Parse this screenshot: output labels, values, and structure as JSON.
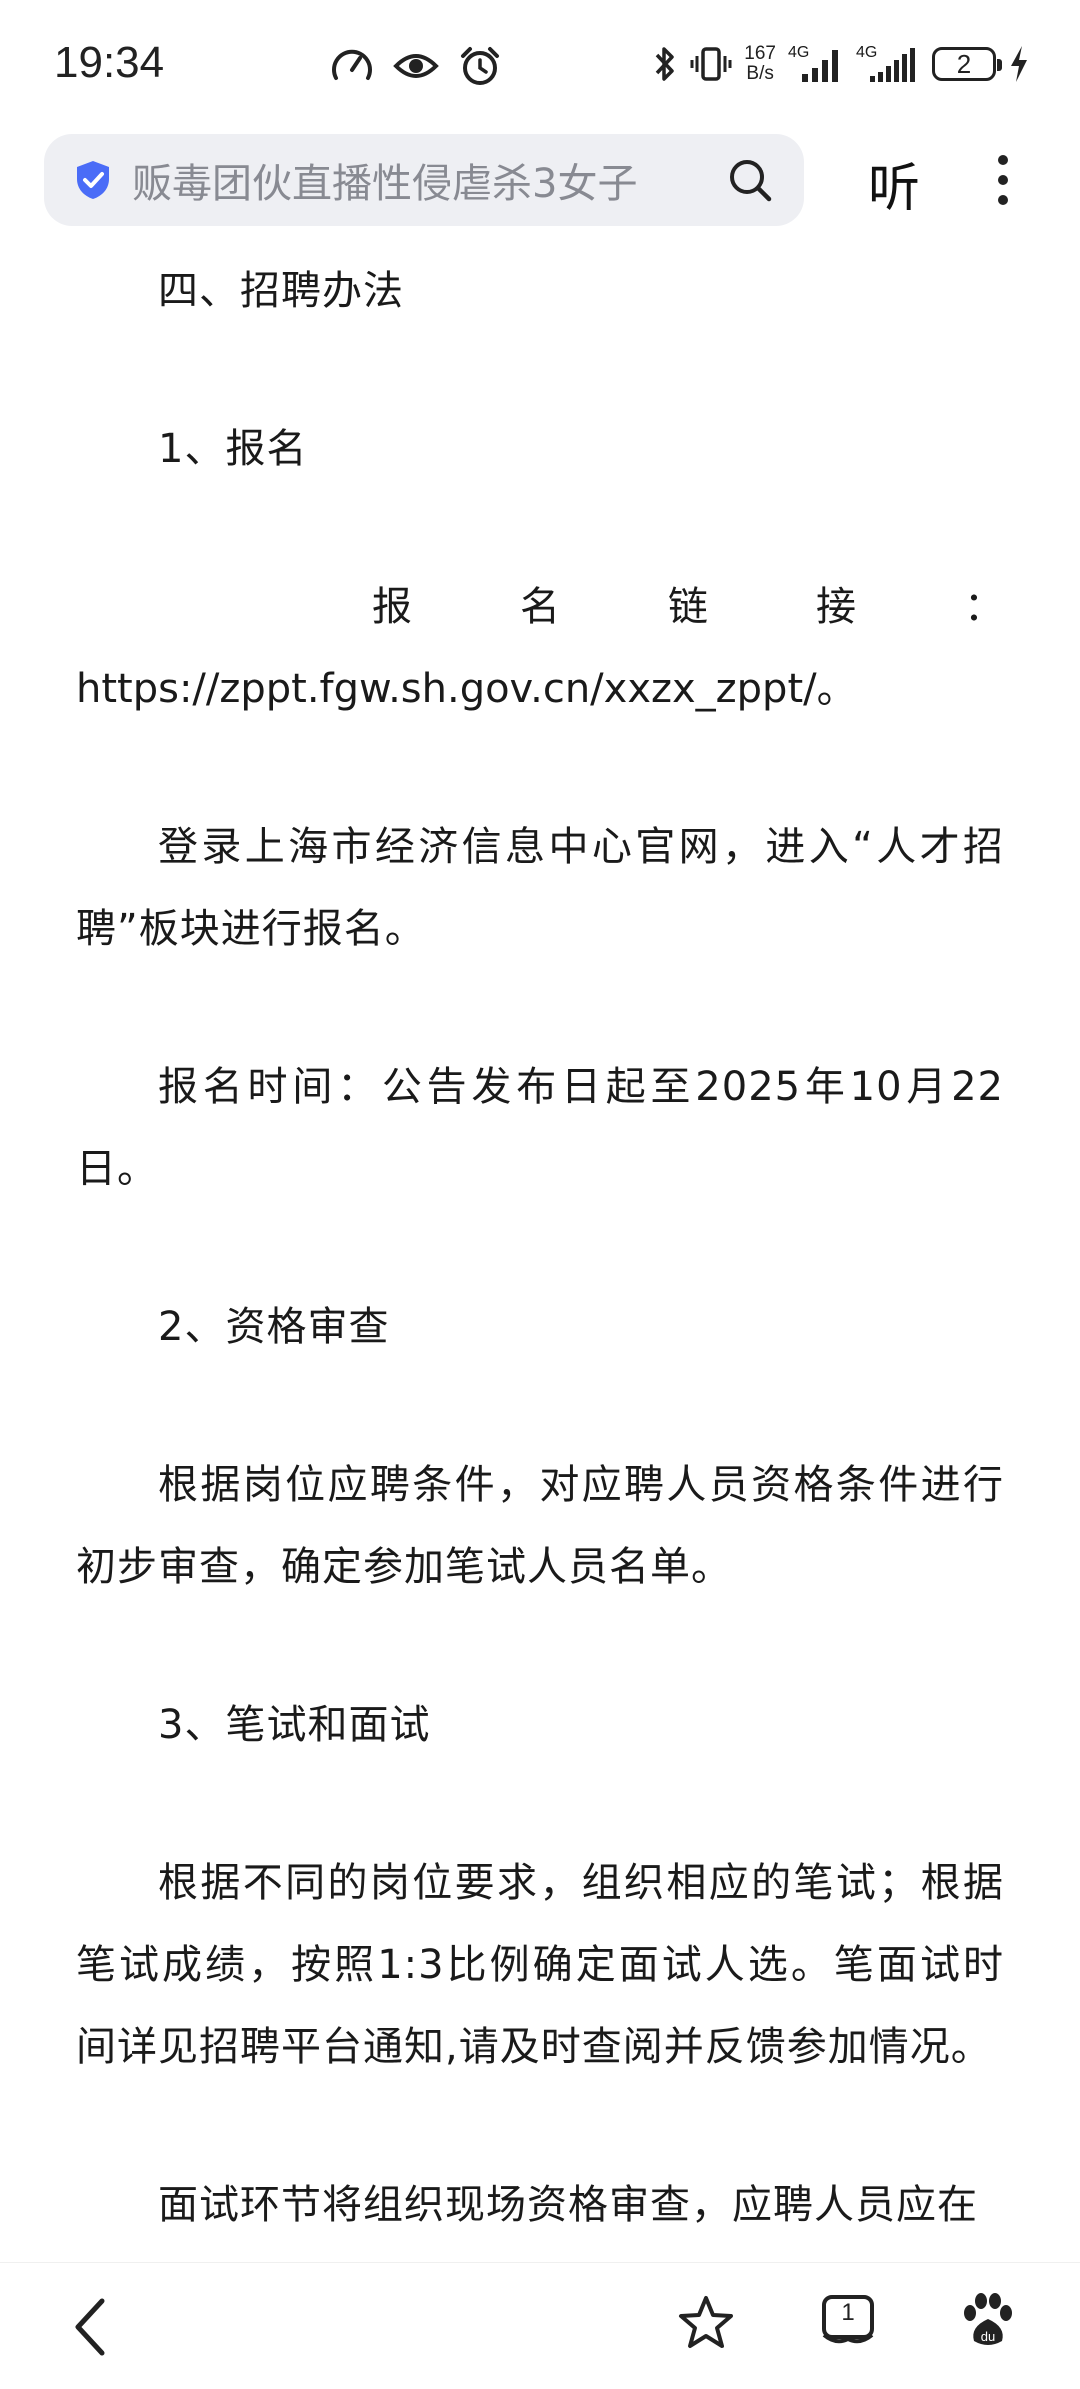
{
  "status_bar": {
    "time": "19:34",
    "net_speed_top": "167",
    "net_speed_bottom": "B/s",
    "signal1": "4G",
    "signal2": "4G",
    "battery": "2"
  },
  "search_bar": {
    "query": "贩毒团伙直播性侵虐杀3女子",
    "listen_label": "听"
  },
  "article": {
    "heading_method": "四、招聘办法",
    "heading_signup": "1、报名",
    "link_label_chars": [
      "报",
      "名",
      "链",
      "接",
      "："
    ],
    "link_url": "https://zppt.fgw.sh.gov.cn/xxzx_zppt/。",
    "para_login": "登录上海市经济信息中心官网，进入“人才招聘”板块进行报名。",
    "para_time": "报名时间：公告发布日起至2025年10月22日。",
    "heading_review": "2、资格审查",
    "para_review": "根据岗位应聘条件，对应聘人员资格条件进行初步审查，确定参加笔试人员名单。",
    "heading_exam": "3、笔试和面试",
    "para_exam": "根据不同的岗位要求，组织相应的笔试；根据笔试成绩，按照1:3比例确定面试人选。笔面试时间详见招聘平台通知,请及时查阅并反馈参加情况。",
    "para_interview": "面试环节将组织现场资格审查，应聘人员应在"
  },
  "bottom_bar": {
    "tab_count": "1"
  },
  "colors": {
    "shield": "#4a6cf7",
    "search_bg": "#eeeff3",
    "text": "#1a1a1a"
  }
}
